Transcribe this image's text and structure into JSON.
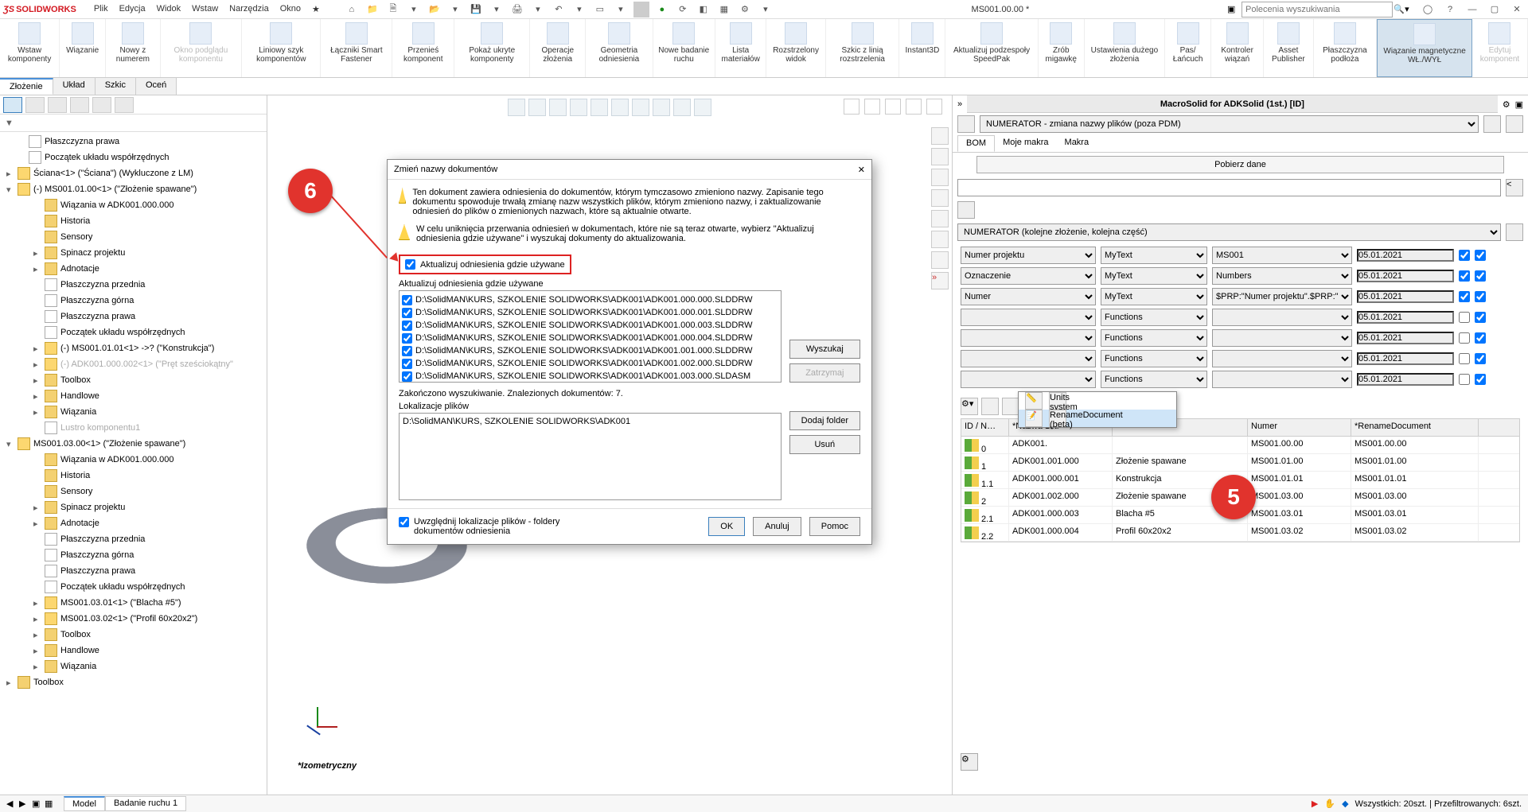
{
  "title": "MS001.00.00 *",
  "logo": "SOLIDWORKS",
  "menu": [
    "Plik",
    "Edycja",
    "Widok",
    "Wstaw",
    "Narzędzia",
    "Okno"
  ],
  "search_placeholder": "Polecenia wyszukiwania",
  "ribbon": [
    {
      "label": "Wstaw komponenty"
    },
    {
      "label": "Wiązanie"
    },
    {
      "label": "Nowy z numerem"
    },
    {
      "label": "Okno podglądu komponentu",
      "disabled": true
    },
    {
      "label": "Liniowy szyk komponentów"
    },
    {
      "label": "Łączniki Smart Fastener"
    },
    {
      "label": "Przenieś komponent"
    },
    {
      "label": "Pokaż ukryte komponenty"
    },
    {
      "label": "Operacje złożenia"
    },
    {
      "label": "Geometria odniesienia"
    },
    {
      "label": "Nowe badanie ruchu"
    },
    {
      "label": "Lista materiałów"
    },
    {
      "label": "Rozstrzelony widok"
    },
    {
      "label": "Szkic z linią rozstrzelenia"
    },
    {
      "label": "Instant3D"
    },
    {
      "label": "Aktualizuj podzespoły SpeedPak"
    },
    {
      "label": "Zrób migawkę"
    },
    {
      "label": "Ustawienia dużego złożenia"
    },
    {
      "label": "Pas/Łańcuch"
    },
    {
      "label": "Kontroler wiązań"
    },
    {
      "label": "Asset Publisher"
    },
    {
      "label": "Płaszczyzna podłoża"
    },
    {
      "label": "Wiązanie magnetyczne WŁ./WYŁ",
      "active": true
    },
    {
      "label": "Edytuj komponent",
      "disabled": true
    }
  ],
  "tabs": [
    "Złożenie",
    "Układ",
    "Szkic",
    "Oceń"
  ],
  "active_tab": 0,
  "tree": [
    {
      "l": "Płaszczyzna prawa",
      "ind": 1,
      "ico": "plane"
    },
    {
      "l": "Początek układu współrzędnych",
      "ind": 1,
      "ico": "origin"
    },
    {
      "l": "Ściana<1> (\"Ściana\") (Wykluczone z LM)",
      "ind": 0,
      "caret": "▸",
      "ico": "asm"
    },
    {
      "l": "(-) MS001.01.00<1> (\"Złożenie spawane\")",
      "ind": 0,
      "caret": "▾",
      "ico": "asm"
    },
    {
      "l": "Wiązania w ADK001.000.000",
      "ind": 2,
      "ico": "folder"
    },
    {
      "l": "Historia",
      "ind": 2,
      "ico": "folder"
    },
    {
      "l": "Sensory",
      "ind": 2,
      "ico": "folder"
    },
    {
      "l": "Spinacz projektu",
      "ind": 2,
      "caret": "▸",
      "ico": "folder"
    },
    {
      "l": "Adnotacje",
      "ind": 2,
      "caret": "▸",
      "ico": "folder"
    },
    {
      "l": "Płaszczyzna przednia",
      "ind": 2,
      "ico": "plane"
    },
    {
      "l": "Płaszczyzna górna",
      "ind": 2,
      "ico": "plane"
    },
    {
      "l": "Płaszczyzna prawa",
      "ind": 2,
      "ico": "plane"
    },
    {
      "l": "Początek układu współrzędnych",
      "ind": 2,
      "ico": "origin"
    },
    {
      "l": "(-) MS001.01.01<1> ->? (\"Konstrukcja\")",
      "ind": 2,
      "caret": "▸",
      "ico": "asm"
    },
    {
      "l": "(-) ADK001.000.002<1> (\"Pręt sześciokątny\"",
      "ind": 2,
      "caret": "▸",
      "ico": "asm",
      "dim": true
    },
    {
      "l": "Toolbox",
      "ind": 2,
      "caret": "▸",
      "ico": "folder"
    },
    {
      "l": "Handlowe",
      "ind": 2,
      "caret": "▸",
      "ico": "folder"
    },
    {
      "l": "Wiązania",
      "ind": 2,
      "caret": "▸",
      "ico": "folder"
    },
    {
      "l": "Lustro komponentu1",
      "ind": 2,
      "ico": "plane",
      "dim": true
    },
    {
      "l": "MS001.03.00<1> (\"Złożenie spawane\")",
      "ind": 0,
      "caret": "▾",
      "ico": "asm"
    },
    {
      "l": "Wiązania w ADK001.000.000",
      "ind": 2,
      "ico": "folder"
    },
    {
      "l": "Historia",
      "ind": 2,
      "ico": "folder"
    },
    {
      "l": "Sensory",
      "ind": 2,
      "ico": "folder"
    },
    {
      "l": "Spinacz projektu",
      "ind": 2,
      "caret": "▸",
      "ico": "folder"
    },
    {
      "l": "Adnotacje",
      "ind": 2,
      "caret": "▸",
      "ico": "folder"
    },
    {
      "l": "Płaszczyzna przednia",
      "ind": 2,
      "ico": "plane"
    },
    {
      "l": "Płaszczyzna górna",
      "ind": 2,
      "ico": "plane"
    },
    {
      "l": "Płaszczyzna prawa",
      "ind": 2,
      "ico": "plane"
    },
    {
      "l": "Początek układu współrzędnych",
      "ind": 2,
      "ico": "origin"
    },
    {
      "l": "MS001.03.01<1> (\"Blacha #5\")",
      "ind": 2,
      "caret": "▸",
      "ico": "asm"
    },
    {
      "l": "MS001.03.02<1> (\"Profil 60x20x2\")",
      "ind": 2,
      "caret": "▸",
      "ico": "asm"
    },
    {
      "l": "Toolbox",
      "ind": 2,
      "caret": "▸",
      "ico": "folder"
    },
    {
      "l": "Handlowe",
      "ind": 2,
      "caret": "▸",
      "ico": "folder"
    },
    {
      "l": "Wiązania",
      "ind": 2,
      "caret": "▸",
      "ico": "folder"
    },
    {
      "l": "Toolbox",
      "ind": 0,
      "caret": "▸",
      "ico": "folder"
    }
  ],
  "viewport_label": "*Izometryczny",
  "rightpane": {
    "title": "MacroSolid for ADKSolid (1st.) [ID]",
    "selector": "NUMERATOR - zmiana nazwy plików (poza PDM)",
    "tabs": [
      "BOM",
      "Moje makra",
      "Makra"
    ],
    "button_top": "Pobierz dane",
    "numerator_mode": "NUMERATOR (kolejne złożenie, kolejna część)",
    "grid": [
      {
        "c1": "Numer projektu",
        "c2": "MyText",
        "c3": "MS001",
        "c4": "05.01.2021",
        "cb1": true,
        "cb2": true
      },
      {
        "c1": "Oznaczenie",
        "c2": "MyText",
        "c3": "Numbers",
        "c4": "05.01.2021",
        "cb1": true,
        "cb2": true
      },
      {
        "c1": "Numer",
        "c2": "MyText",
        "c3": "$PRP:\"Numer projektu\".$PRP:\"",
        "c4": "05.01.2021",
        "cb1": true,
        "cb2": true
      },
      {
        "c1": "",
        "c2": "Functions",
        "c3": "",
        "c4": "05.01.2021",
        "cb1": false,
        "cb2": true
      },
      {
        "c1": "",
        "c2": "Functions",
        "c3": "",
        "c4": "05.01.2021",
        "cb1": false,
        "cb2": true
      },
      {
        "c1": "",
        "c2": "Functions",
        "c3": "",
        "c4": "05.01.2021",
        "cb1": false,
        "cb2": true
      },
      {
        "c1": "",
        "c2": "Functions",
        "c3": "",
        "c4": "05.01.2021",
        "cb1": false,
        "cb2": true
      }
    ],
    "context": [
      {
        "label": "Units system"
      },
      {
        "label": "RenameDocument (beta)",
        "hover": true
      }
    ],
    "table": {
      "headers": [
        "ID / N…",
        "*Nazwa 1st.",
        "",
        "Numer",
        "*RenameDocument"
      ],
      "rows": [
        {
          "id": "0",
          "name": "ADK001.",
          "tsz": "",
          "num": "MS001.00.00",
          "rn": "MS001.00.00"
        },
        {
          "id": "1",
          "name": "ADK001.001.000",
          "tsz": "Złożenie spawane",
          "num": "MS001.01.00",
          "rn": "MS001.01.00"
        },
        {
          "id": "1.1",
          "name": "ADK001.000.001",
          "tsz": "Konstrukcja",
          "num": "MS001.01.01",
          "rn": "MS001.01.01"
        },
        {
          "id": "2",
          "name": "ADK001.002.000",
          "tsz": "Złożenie spawane",
          "num": "MS001.03.00",
          "rn": "MS001.03.00"
        },
        {
          "id": "2.1",
          "name": "ADK001.000.003",
          "tsz": "Blacha #5",
          "num": "MS001.03.01",
          "rn": "MS001.03.01"
        },
        {
          "id": "2.2",
          "name": "ADK001.000.004",
          "tsz": "Profil 60x20x2",
          "num": "MS001.03.02",
          "rn": "MS001.03.02"
        }
      ]
    }
  },
  "dialog": {
    "title": "Zmień nazwy dokumentów",
    "warn1": "Ten dokument zawiera odniesienia do dokumentów, którym tymczasowo zmieniono nazwy. Zapisanie tego dokumentu spowoduje trwałą zmianę nazw wszystkich plików, którym zmieniono nazwy, i zaktualizowanie odniesień do plików o zmienionych nazwach, które są aktualnie otwarte.",
    "warn2": "W celu uniknięcia przerwania odniesień w dokumentach, które nie są teraz otwarte, wybierz \"Aktualizuj odniesienia gdzie używane\" i wyszukaj dokumenty do aktualizowania.",
    "chk_label": "Aktualizuj odniesienia gdzie używane",
    "list_label": "Aktualizuj odniesienia gdzie używane",
    "files": [
      "D:\\SolidMAN\\KURS, SZKOLENIE SOLIDWORKS\\ADK001\\ADK001.000.000.SLDDRW",
      "D:\\SolidMAN\\KURS, SZKOLENIE SOLIDWORKS\\ADK001\\ADK001.000.001.SLDDRW",
      "D:\\SolidMAN\\KURS, SZKOLENIE SOLIDWORKS\\ADK001\\ADK001.000.003.SLDDRW",
      "D:\\SolidMAN\\KURS, SZKOLENIE SOLIDWORKS\\ADK001\\ADK001.000.004.SLDDRW",
      "D:\\SolidMAN\\KURS, SZKOLENIE SOLIDWORKS\\ADK001\\ADK001.001.000.SLDDRW",
      "D:\\SolidMAN\\KURS, SZKOLENIE SOLIDWORKS\\ADK001\\ADK001.002.000.SLDDRW",
      "D:\\SolidMAN\\KURS, SZKOLENIE SOLIDWORKS\\ADK001\\ADK001.003.000.SLDASM"
    ],
    "status": "Zakończono wyszukiwanie. Znalezionych dokumentów: 7.",
    "btn_search": "Wyszukaj",
    "btn_stop": "Zatrzymaj",
    "loc_label": "Lokalizacje plików",
    "loc_value": "D:\\SolidMAN\\KURS, SZKOLENIE SOLIDWORKS\\ADK001",
    "btn_addfolder": "Dodaj folder",
    "btn_remove": "Usuń",
    "chk_footer": "Uwzględnij lokalizacje plików - foldery dokumentów odniesienia",
    "btn_ok": "OK",
    "btn_cancel": "Anuluj",
    "btn_help": "Pomoc"
  },
  "callouts": {
    "c5": "5",
    "c6": "6"
  },
  "statusbar": {
    "tabs": [
      "Model",
      "Badanie ruchu 1"
    ],
    "right": "Wszystkich: 20szt. | Przefiltrowanych: 6szt."
  }
}
